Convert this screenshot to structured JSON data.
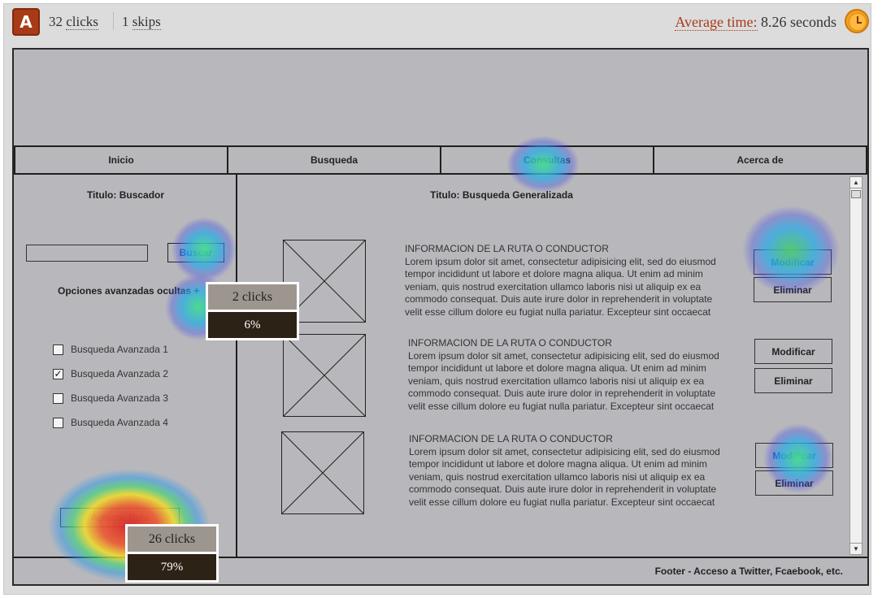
{
  "stats": {
    "badge": "A",
    "clicks_count": "32",
    "clicks_label": "clicks",
    "skips_count": "1",
    "skips_label": "skips",
    "avg_label": "Average time:",
    "avg_value": "8.26 seconds"
  },
  "nav": [
    "Inicio",
    "Busqueda",
    "Consultas",
    "Acerca de"
  ],
  "sidebar": {
    "title": "Titulo: Buscador",
    "search_button": "Buscar",
    "advanced_toggle": "Opciones avanzadas ocultas +",
    "checkboxes": [
      {
        "label": "Busqueda Avanzada 1",
        "checked": false
      },
      {
        "label": "Busqueda Avanzada 2",
        "checked": true
      },
      {
        "label": "Busqueda Avanzada 3",
        "checked": false
      },
      {
        "label": "Busqueda Avanzada 4",
        "checked": false
      }
    ],
    "add_button": "Agregar Ruta"
  },
  "main": {
    "title": "Titulo: Busqueda Generalizada",
    "results": [
      {
        "heading": "INFORMACION DE LA RUTA O CONDUCTOR",
        "lines": [
          "Lorem ipsum dolor sit amet, consectetur adipisicing elit, sed do eiusmod",
          "tempor incididunt ut labore et dolore magna aliqua. Ut enim ad minim",
          "veniam, quis nostrud exercitation ullamco laboris nisi ut aliquip ex ea",
          "commodo consequat. Duis aute irure dolor in reprehenderit in voluptate",
          "velit esse cillum dolore eu fugiat nulla pariatur. Excepteur sint occaecat"
        ],
        "modify": "Modificar",
        "delete": "Eliminar"
      },
      {
        "heading": "INFORMACION DE LA RUTA O CONDUCTOR",
        "lines": [
          "Lorem ipsum dolor sit amet, consectetur adipisicing elit, sed do eiusmod",
          "tempor incididunt ut labore et dolore magna aliqua. Ut enim ad minim",
          "veniam, quis nostrud exercitation ullamco laboris nisi ut aliquip ex ea",
          "commodo consequat. Duis aute irure dolor in reprehenderit in voluptate",
          "velit esse cillum dolore eu fugiat nulla pariatur. Excepteur sint occaecat"
        ],
        "modify": "Modificar",
        "delete": "Eliminar"
      },
      {
        "heading": "INFORMACION DE LA RUTA O CONDUCTOR",
        "lines": [
          "Lorem ipsum dolor sit amet, consectetur adipisicing elit, sed do eiusmod",
          "tempor incididunt ut labore et dolore magna aliqua. Ut enim ad minim",
          "veniam, quis nostrud exercitation ullamco laboris nisi ut aliquip ex ea",
          "commodo consequat. Duis aute irure dolor in reprehenderit in voluptate",
          "velit esse cillum dolore eu fugiat nulla pariatur. Excepteur sint occaecat"
        ],
        "modify": "Modificar",
        "delete": "Eliminar"
      }
    ]
  },
  "footer": "Footer - Acceso a Twitter, Fcaebook, etc.",
  "heatmap": {
    "tooltips": [
      {
        "clicks": "2 clicks",
        "percent": "6%"
      },
      {
        "clicks": "26 clicks",
        "percent": "79%"
      }
    ]
  },
  "colors": {
    "accent": "#a83a18",
    "canvas": "#b8b8bc",
    "tooltip_dark": "#2d2216",
    "tooltip_light": "#9c968e"
  }
}
